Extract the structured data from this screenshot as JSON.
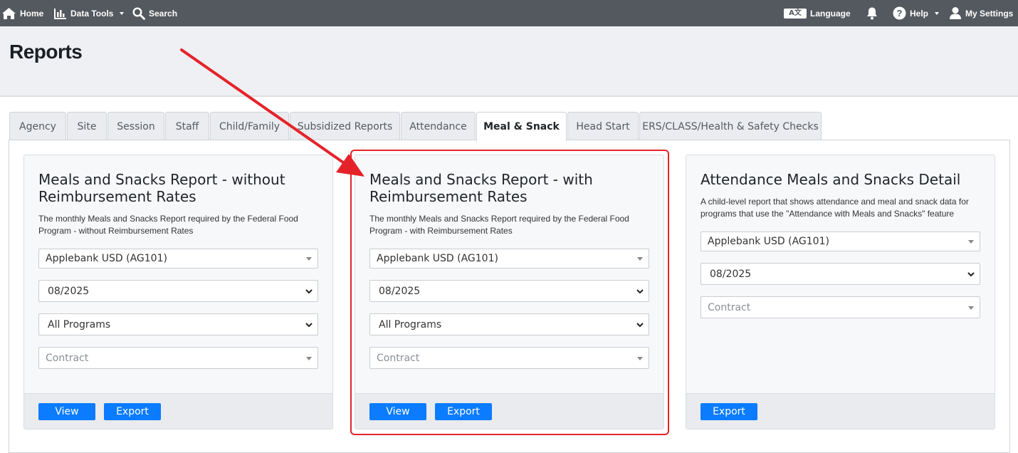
{
  "nav": {
    "home": "Home",
    "data_tools": "Data Tools",
    "search": "Search",
    "language": "Language",
    "language_badge": "A文",
    "help": "Help",
    "settings": "My Settings"
  },
  "page": {
    "title": "Reports"
  },
  "tabs": [
    {
      "label": "Agency"
    },
    {
      "label": "Site"
    },
    {
      "label": "Session"
    },
    {
      "label": "Staff"
    },
    {
      "label": "Child/Family"
    },
    {
      "label": "Subsidized Reports"
    },
    {
      "label": "Attendance"
    },
    {
      "label": "Meal & Snack",
      "active": true
    },
    {
      "label": "Head Start"
    },
    {
      "label": "ERS/CLASS/Health & Safety Checks"
    }
  ],
  "cards": [
    {
      "title": "Meals and Snacks Report - without Reimbursement Rates",
      "description": "The monthly Meals and Snacks Report required by the Federal Food Program - without Reimbursement Rates",
      "agency": "Applebank USD (AG101)",
      "month": "08/2025",
      "program": "All Programs",
      "contract_placeholder": "Contract",
      "view_label": "View",
      "export_label": "Export"
    },
    {
      "title": "Meals and Snacks Report - with Reimbursement Rates",
      "description": "The monthly Meals and Snacks Report required by the Federal Food Program - with Reimbursement Rates",
      "agency": "Applebank USD (AG101)",
      "month": "08/2025",
      "program": "All Programs",
      "contract_placeholder": "Contract",
      "view_label": "View",
      "export_label": "Export"
    },
    {
      "title": "Attendance Meals and Snacks Detail",
      "description": "A child-level report that shows attendance and meal and snack data for programs that use the \"Attendance with Meals and Snacks\" feature",
      "agency": "Applebank USD (AG101)",
      "month": "08/2025",
      "contract_placeholder": "Contract",
      "export_label": "Export"
    }
  ],
  "colors": {
    "nav_bg": "#54585f",
    "accent_button": "#0b7cff",
    "annotation_red": "#e5222a"
  }
}
